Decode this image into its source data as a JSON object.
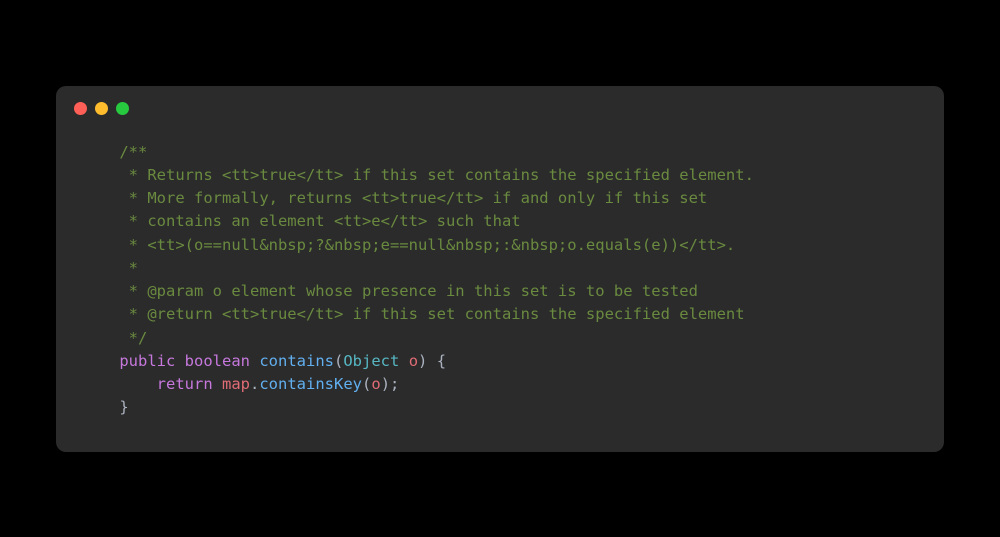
{
  "window": {
    "traffic_lights": {
      "red": "close",
      "yellow": "minimize",
      "green": "maximize"
    }
  },
  "code": {
    "lines": [
      {
        "indent": "    ",
        "tokens": [
          {
            "cls": "comment",
            "t": "/**"
          }
        ]
      },
      {
        "indent": "     ",
        "tokens": [
          {
            "cls": "comment",
            "t": "* Returns <tt>true</tt> if this set contains the specified element."
          }
        ]
      },
      {
        "indent": "     ",
        "tokens": [
          {
            "cls": "comment",
            "t": "* More formally, returns <tt>true</tt> if and only if this set"
          }
        ]
      },
      {
        "indent": "     ",
        "tokens": [
          {
            "cls": "comment",
            "t": "* contains an element <tt>e</tt> such that"
          }
        ]
      },
      {
        "indent": "     ",
        "tokens": [
          {
            "cls": "comment",
            "t": "* <tt>(o==null&nbsp;?&nbsp;e==null&nbsp;:&nbsp;o.equals(e))</tt>."
          }
        ]
      },
      {
        "indent": "     ",
        "tokens": [
          {
            "cls": "comment",
            "t": "*"
          }
        ]
      },
      {
        "indent": "     ",
        "tokens": [
          {
            "cls": "comment",
            "t": "* @param o element whose presence in this set is to be tested"
          }
        ]
      },
      {
        "indent": "     ",
        "tokens": [
          {
            "cls": "comment",
            "t": "* @return <tt>true</tt> if this set contains the specified element"
          }
        ]
      },
      {
        "indent": "     ",
        "tokens": [
          {
            "cls": "comment",
            "t": "*/"
          }
        ]
      },
      {
        "indent": "    ",
        "tokens": [
          {
            "cls": "keyword",
            "t": "public"
          },
          {
            "cls": "",
            "t": " "
          },
          {
            "cls": "keyword",
            "t": "boolean"
          },
          {
            "cls": "",
            "t": " "
          },
          {
            "cls": "method",
            "t": "contains"
          },
          {
            "cls": "paren",
            "t": "("
          },
          {
            "cls": "type",
            "t": "Object"
          },
          {
            "cls": "",
            "t": " "
          },
          {
            "cls": "variable",
            "t": "o"
          },
          {
            "cls": "paren",
            "t": ")"
          },
          {
            "cls": "",
            "t": " "
          },
          {
            "cls": "brace",
            "t": "{"
          }
        ]
      },
      {
        "indent": "        ",
        "tokens": [
          {
            "cls": "keyword",
            "t": "return"
          },
          {
            "cls": "",
            "t": " "
          },
          {
            "cls": "variable",
            "t": "map"
          },
          {
            "cls": "paren",
            "t": "."
          },
          {
            "cls": "method",
            "t": "containsKey"
          },
          {
            "cls": "paren",
            "t": "("
          },
          {
            "cls": "variable",
            "t": "o"
          },
          {
            "cls": "paren",
            "t": ")"
          },
          {
            "cls": "semi",
            "t": ";"
          }
        ]
      },
      {
        "indent": "    ",
        "tokens": [
          {
            "cls": "brace",
            "t": "}"
          }
        ]
      }
    ]
  }
}
